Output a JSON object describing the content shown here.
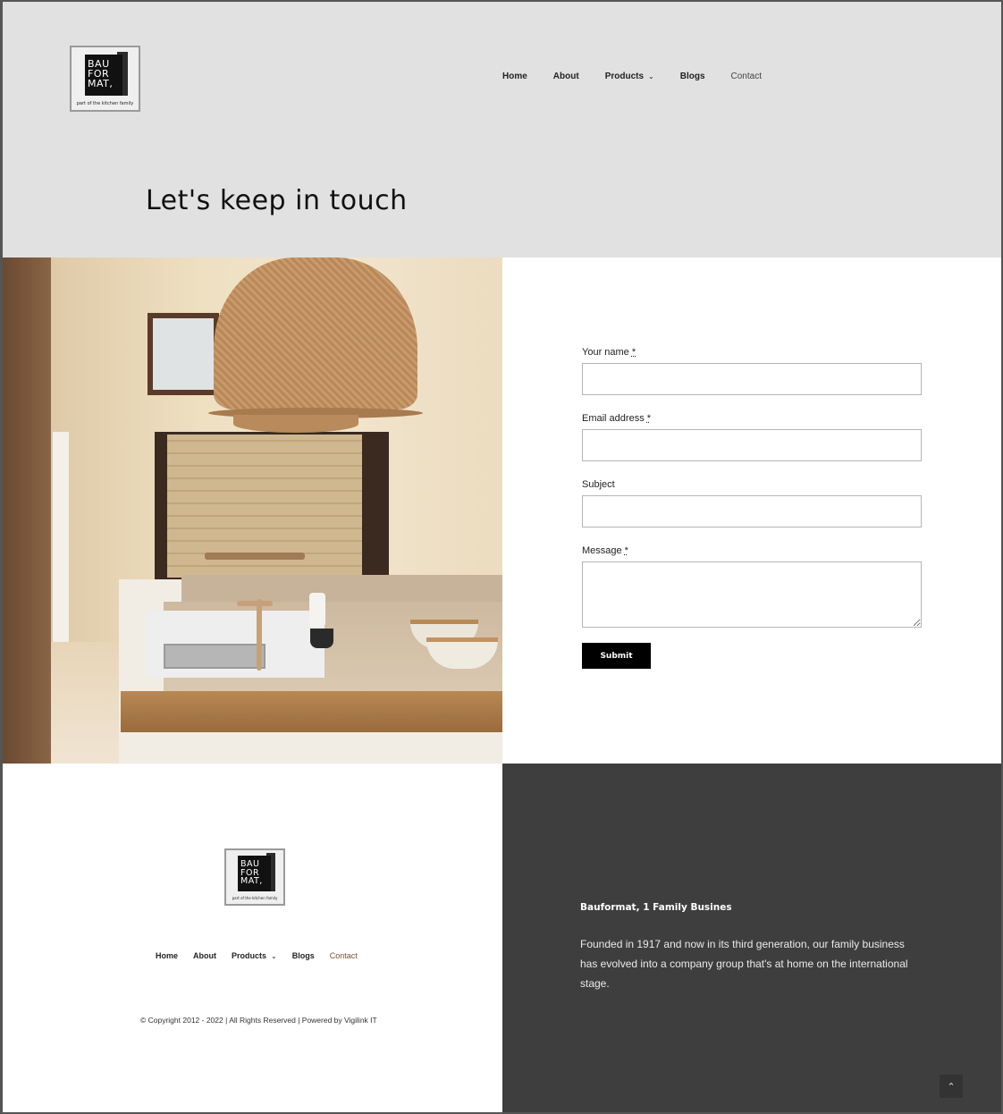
{
  "brand": {
    "logo_lines": [
      "BAU",
      "FOR",
      "MAT,"
    ],
    "logo_tagline": "part of the kitchen family"
  },
  "nav": {
    "items": [
      {
        "label": "Home"
      },
      {
        "label": "About"
      },
      {
        "label": "Products"
      },
      {
        "label": "Blogs"
      },
      {
        "label": "Contact"
      }
    ]
  },
  "hero": {
    "title": "Let's keep in touch"
  },
  "form": {
    "name_label": "Your name",
    "email_label": "Email address",
    "subject_label": "Subject",
    "message_label": "Message",
    "required_mark": "*",
    "name_value": "",
    "email_value": "",
    "subject_value": "",
    "message_value": "",
    "submit_label": "Submit"
  },
  "footer": {
    "copyright": "© Copyright 2012 - 2022 | All Rights Reserved | Powered by Vigilink IT",
    "heading": "Bauformat, 1 Family Busines",
    "text": "Founded in 1917 and now in its third generation, our family business has evolved into a company group that's at home on the international stage.",
    "back_to_top": "⌃"
  },
  "icons": {
    "chevron": "chevron-down-icon",
    "back_to_top": "chevron-up-icon"
  }
}
